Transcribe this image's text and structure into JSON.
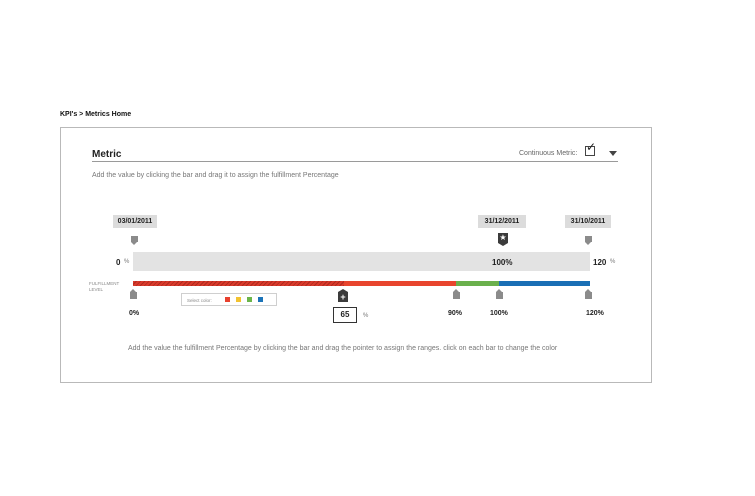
{
  "breadcrumb": "KPI's > Metrics Home",
  "metric": {
    "title": "Metric",
    "continuous_label": "Continuous Metric:",
    "continuous_checked": true,
    "instruction_top": "Add the value by clicking the bar and drag it to assign the fulfillment Percentage",
    "instruction_bottom": "Add the value the fulfillment Percentage by clicking the bar and drag the pointer to assign the ranges. click on each bar to change the color"
  },
  "timeline": {
    "start_date": "03/01/2011",
    "target_date": "31/12/2011",
    "end_date": "31/10/2011",
    "start_pct": "0",
    "start_unit": "%",
    "progress_label": "100%",
    "end_pct": "120",
    "end_unit": "%"
  },
  "fulfillment": {
    "level_label_line1": "FULFILLMENT",
    "level_label_line2": "LEVEL",
    "pointer_value": "65",
    "pointer_unit": "%",
    "scale_labels": [
      "0%",
      "90%",
      "100%",
      "120%"
    ],
    "color_picker_label": "Select color:",
    "swatch_colors": [
      "#e8412e",
      "#f2c230",
      "#6bb54a",
      "#1b73b8"
    ],
    "segment_colors": {
      "red": "#e8452e",
      "green": "#6ab04c",
      "blue": "#1a6fb5"
    }
  }
}
